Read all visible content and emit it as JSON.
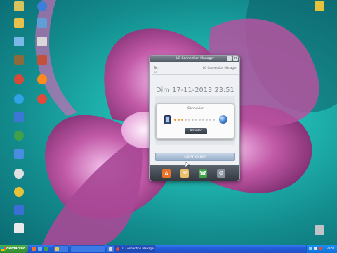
{
  "desktop": {
    "icons_left": [
      {
        "name": "desktop-icon-1",
        "label": "",
        "color": "#d9c45c"
      },
      {
        "name": "desktop-icon-2",
        "label": "",
        "color": "#3b7fd9"
      },
      {
        "name": "desktop-icon-3",
        "label": "",
        "color": "#e8c04c"
      },
      {
        "name": "desktop-icon-4",
        "label": "",
        "color": "#5f9fd6"
      },
      {
        "name": "desktop-icon-5",
        "label": "",
        "color": "#7ab8e8"
      },
      {
        "name": "desktop-icon-6",
        "label": "",
        "color": "#d8d8d8"
      },
      {
        "name": "desktop-icon-7",
        "label": "",
        "color": "#8c6a3a"
      },
      {
        "name": "desktop-icon-8",
        "label": "",
        "color": "#c44f3a"
      },
      {
        "name": "desktop-icon-9",
        "label": "",
        "color": "#d64a3a"
      },
      {
        "name": "desktop-icon-10",
        "label": "",
        "color": "#ff8a1e"
      },
      {
        "name": "desktop-icon-11",
        "label": "",
        "color": "#2fa3e6"
      },
      {
        "name": "desktop-icon-12",
        "label": "",
        "color": "#e04a3a"
      },
      {
        "name": "desktop-icon-13",
        "label": "",
        "color": "#3a78d4"
      },
      {
        "name": "desktop-icon-14",
        "label": "",
        "color": "#3fa24a"
      },
      {
        "name": "desktop-icon-15",
        "label": "",
        "color": "#4a8de0"
      },
      {
        "name": "desktop-icon-16",
        "label": "",
        "color": "#e0e0e0"
      },
      {
        "name": "desktop-icon-17",
        "label": "",
        "color": "#e6c23a"
      },
      {
        "name": "desktop-icon-18",
        "label": "",
        "color": "#3c6fd6"
      },
      {
        "name": "desktop-icon-19",
        "label": "",
        "color": "#e9e9e9"
      },
      {
        "name": "desktop-icon-20",
        "label": "",
        "color": "#2f5fb8"
      }
    ],
    "icon_right_top": {
      "label": "",
      "color": "#e6c23a"
    },
    "icon_right_bottom": {
      "label": "",
      "color": "#c0c4c8"
    }
  },
  "lg_window": {
    "title": "LG Connection Manager",
    "status_signal": "Tel.",
    "status_apn": "3G",
    "brand_line": "LG Connection Manager",
    "datetime": "Dim 17-11-2013 23:51",
    "dialog": {
      "title": "Connexion",
      "cancel_label": "Annuler",
      "progress_dots_total": 12,
      "progress_dots_active": 3
    },
    "connect_label": "Connexion",
    "dock_icons": [
      {
        "name": "home-icon",
        "glyph": "⌂",
        "color": "#e8742c"
      },
      {
        "name": "message-icon",
        "glyph": "✉",
        "color": "#e9c06a"
      },
      {
        "name": "contacts-icon",
        "glyph": "☎",
        "color": "#3fa24a"
      },
      {
        "name": "settings-icon",
        "glyph": "⚙",
        "color": "#8a939c"
      }
    ]
  },
  "taskbar": {
    "start_label": "démarrer",
    "tasks": [
      {
        "label": "",
        "color": "#f0c24a"
      },
      {
        "label": "",
        "color": "#3c7be6"
      },
      {
        "label": "",
        "color": "#d9d9d9"
      },
      {
        "label": "LG Connection Manager",
        "color": "#e04a3a"
      }
    ],
    "clock": "23:51"
  }
}
